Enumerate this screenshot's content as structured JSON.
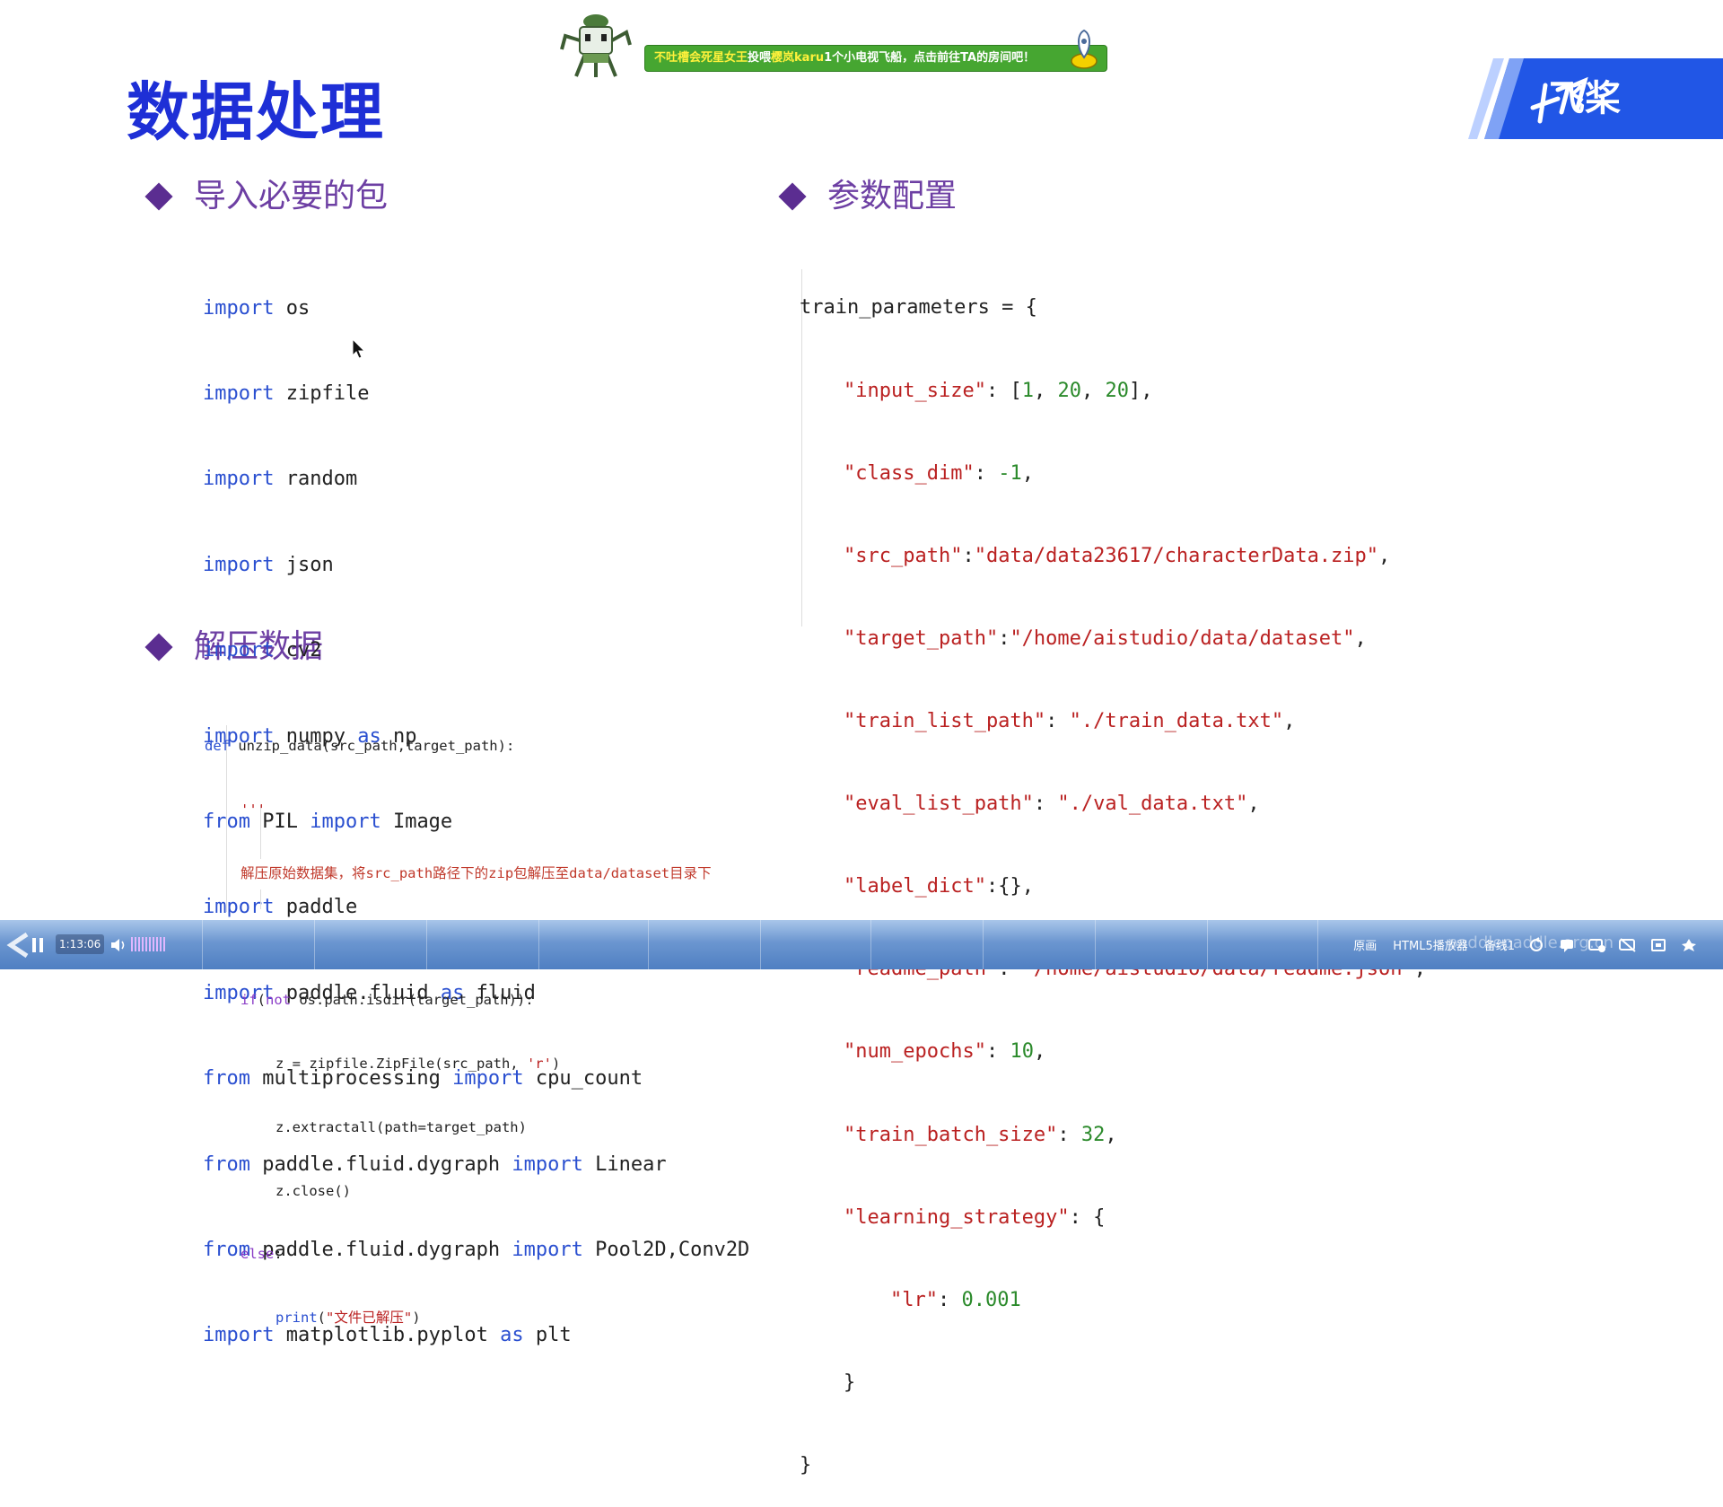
{
  "slide": {
    "title": "数据处理",
    "logo_text": "飞桨"
  },
  "gift_banner": {
    "user": "不吐槽会死星女王",
    "verb": "投喂",
    "target": "樱岚karu",
    "rest": "1个小电视飞船，点击前往TA的房间吧！"
  },
  "sections": {
    "imports_heading": "导入必要的包",
    "params_heading": "参数配置",
    "unzip_heading": "解压数据"
  },
  "imports_code": [
    {
      "kw": "import",
      "rest": " os"
    },
    {
      "kw": "import",
      "rest": " zipfile"
    },
    {
      "kw": "import",
      "rest": " random"
    },
    {
      "kw": "import",
      "rest": " json"
    },
    {
      "kw": "import",
      "rest": " cv2"
    },
    {
      "kw": "import",
      "rest": " numpy ",
      "kw2": "as",
      "rest2": " np"
    },
    {
      "kw": "from",
      "rest": " PIL ",
      "kw2": "import",
      "rest2": " Image"
    },
    {
      "kw": "import",
      "rest": " paddle"
    },
    {
      "kw": "import",
      "rest": " paddle.fluid ",
      "kw2": "as",
      "rest2": " fluid"
    },
    {
      "kw": "from",
      "rest": " multiprocessing ",
      "kw2": "import",
      "rest2": " cpu_count"
    },
    {
      "kw": "from",
      "rest": " paddle.fluid.dygraph ",
      "kw2": "import",
      "rest2": " Linear"
    },
    {
      "kw": "from",
      "rest": " paddle.fluid.dygraph ",
      "kw2": "import",
      "rest2": " Pool2D,Conv2D"
    },
    {
      "kw": "import",
      "rest": " matplotlib.pyplot ",
      "kw2": "as",
      "rest2": " plt"
    }
  ],
  "params_code": {
    "open": "train_parameters = {",
    "lines": [
      {
        "key": "\"input_size\"",
        "sep": ": [",
        "val": "",
        "nums": [
          "1",
          "20",
          "20"
        ],
        "tail": "],"
      },
      {
        "key": "\"class_dim\"",
        "sep": ": ",
        "num": "-1",
        "tail": ","
      },
      {
        "key": "\"src_path\"",
        "sep": ":",
        "str": "\"data/data23617/characterData.zip\"",
        "tail": ","
      },
      {
        "key": "\"target_path\"",
        "sep": ":",
        "str": "\"/home/aistudio/data/dataset\"",
        "tail": ","
      },
      {
        "key": "\"train_list_path\"",
        "sep": ": ",
        "str": "\"./train_data.txt\"",
        "tail": ","
      },
      {
        "key": "\"eval_list_path\"",
        "sep": ": ",
        "str": "\"./val_data.txt\"",
        "tail": ","
      },
      {
        "key": "\"label_dict\"",
        "sep": ":{},",
        "tail": ""
      },
      {
        "key": "\"readme_path\"",
        "sep": ": ",
        "str": "\"/home/aistudio/data/readme.json\"",
        "tail": ","
      },
      {
        "key": "\"num_epochs\"",
        "sep": ": ",
        "num": "10",
        "tail": ","
      },
      {
        "key": "\"train_batch_size\"",
        "sep": ": ",
        "num": "32",
        "tail": ","
      },
      {
        "key": "\"learning_strategy\"",
        "sep": ": {",
        "tail": ""
      }
    ],
    "lr_key": "\"lr\"",
    "lr_sep": ": ",
    "lr_val": "0.001",
    "inner_close": "}",
    "outer_close": "}"
  },
  "unzip_code": {
    "def_kw": "def",
    "def_rest": " unzip_data(src_path,target_path):",
    "docq1": "'''",
    "doc": "解压原始数据集，将src_path路径下的zip包解压至data/dataset目录下",
    "docq2": "'''",
    "if_kw": "if",
    "not_kw": "not",
    "if_rest1": "(",
    "if_rest2": " os.path.isdir(target_path)):",
    "z1": "z = zipfile.ZipFile(src_path, ",
    "z1_str": "'r'",
    "z1_end": ")",
    "z2": "z.extractall(path=target_path)",
    "z3": "z.close()",
    "else_kw": "else",
    "else_colon": ":",
    "print_kw": "print",
    "print_open": "(",
    "print_str": "\"文件已解压\"",
    "print_close": ")"
  },
  "player": {
    "time": "1:13:06",
    "watermark": "paddlepaddle.org.cn",
    "right_items": [
      "原画",
      "HTML5播放器",
      "备线1"
    ],
    "right_icons": [
      "loop-icon",
      "danmaku-input-icon",
      "danmaku-settings-icon",
      "danmaku-off-icon",
      "fullscreen-window-icon",
      "fullscreen-icon"
    ]
  },
  "colors": {
    "title_blue": "#1e2fd6",
    "heading_purple": "#6d3fa3",
    "bullet_purple": "#5b2d91",
    "keyword_blue": "#2a4fd0",
    "string_red": "#ba2121",
    "number_green": "#2b8a2b",
    "banner_green": "#46a631",
    "logo_blue": "#2156e6"
  }
}
